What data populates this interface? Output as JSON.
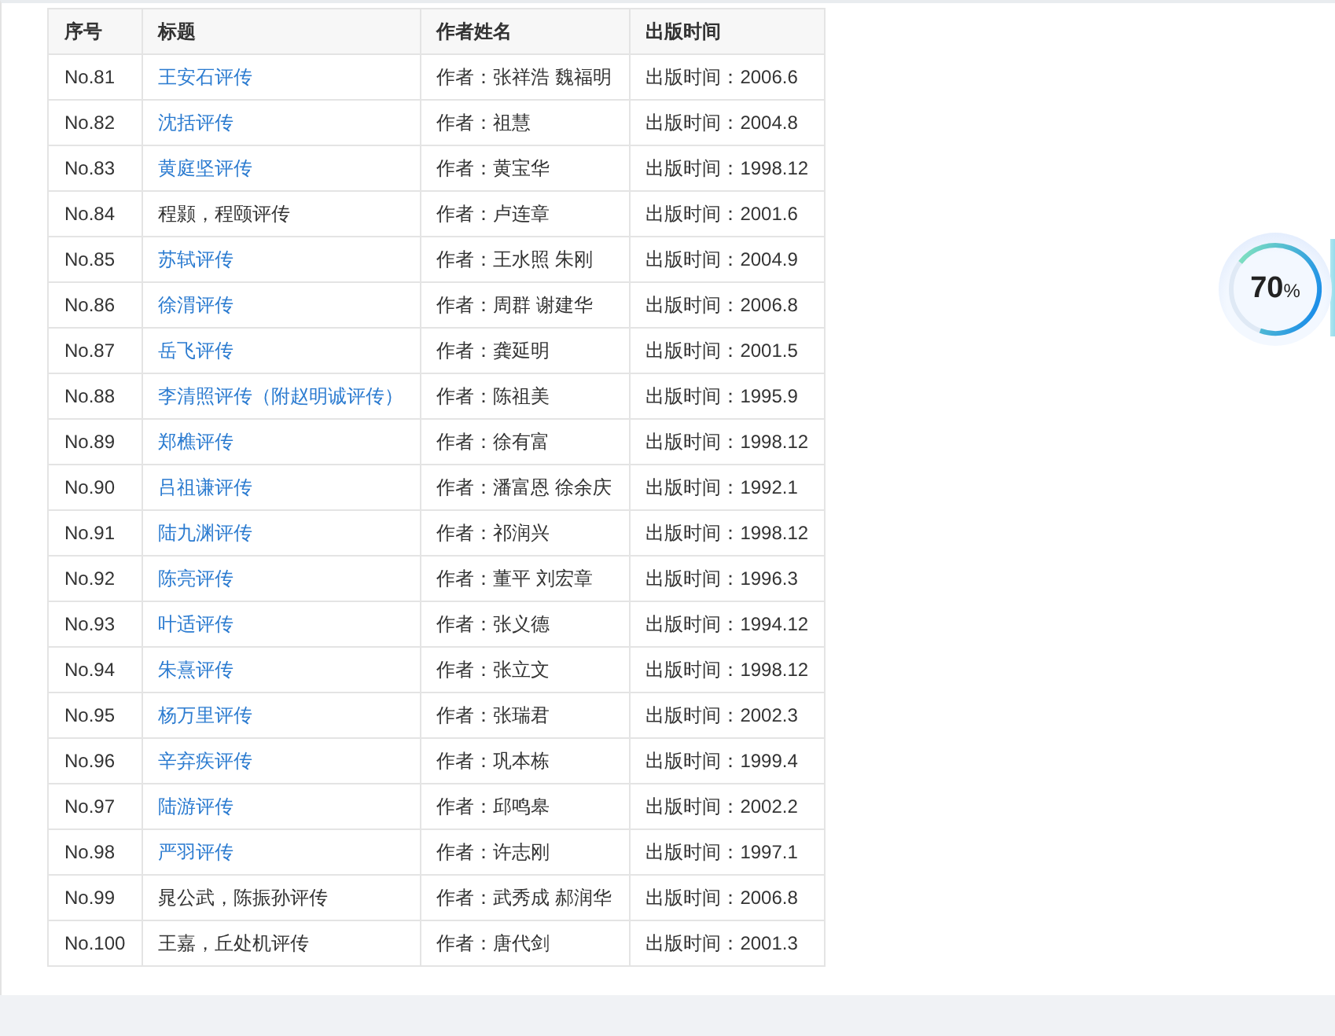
{
  "table": {
    "columns": [
      "序号",
      "标题",
      "作者姓名",
      "出版时间"
    ],
    "rows": [
      {
        "no": "No.81",
        "title": "王安石评传",
        "linked": true,
        "author": "作者：张祥浩 魏福明",
        "date": "出版时间：2006.6"
      },
      {
        "no": "No.82",
        "title": "沈括评传",
        "linked": true,
        "author": "作者：祖慧",
        "date": "出版时间：2004.8"
      },
      {
        "no": "No.83",
        "title": "黄庭坚评传",
        "linked": true,
        "author": "作者：黄宝华",
        "date": "出版时间：1998.12"
      },
      {
        "no": "No.84",
        "title": "程颢，程颐评传",
        "linked": false,
        "author": "作者：卢连章",
        "date": "出版时间：2001.6"
      },
      {
        "no": "No.85",
        "title": "苏轼评传",
        "linked": true,
        "author": "作者：王水照 朱刚",
        "date": "出版时间：2004.9"
      },
      {
        "no": "No.86",
        "title": "徐渭评传",
        "linked": true,
        "author": "作者：周群 谢建华",
        "date": "出版时间：2006.8"
      },
      {
        "no": "No.87",
        "title": "岳飞评传",
        "linked": true,
        "author": "作者：龚延明",
        "date": "出版时间：2001.5"
      },
      {
        "no": "No.88",
        "title": "李清照评传（附赵明诚评传）",
        "linked": true,
        "author": "作者：陈祖美",
        "date": "出版时间：1995.9"
      },
      {
        "no": "No.89",
        "title": "郑樵评传",
        "linked": true,
        "author": "作者：徐有富",
        "date": "出版时间：1998.12"
      },
      {
        "no": "No.90",
        "title": "吕祖谦评传",
        "linked": true,
        "author": "作者：潘富恩 徐余庆",
        "date": "出版时间：1992.1"
      },
      {
        "no": "No.91",
        "title": "陆九渊评传",
        "linked": true,
        "author": "作者：祁润兴",
        "date": "出版时间：1998.12"
      },
      {
        "no": "No.92",
        "title": "陈亮评传",
        "linked": true,
        "author": "作者：董平 刘宏章",
        "date": "出版时间：1996.3"
      },
      {
        "no": "No.93",
        "title": "叶适评传",
        "linked": true,
        "author": "作者：张义德",
        "date": "出版时间：1994.12"
      },
      {
        "no": "No.94",
        "title": "朱熹评传",
        "linked": true,
        "author": "作者：张立文",
        "date": "出版时间：1998.12"
      },
      {
        "no": "No.95",
        "title": "杨万里评传",
        "linked": true,
        "author": "作者：张瑞君",
        "date": "出版时间：2002.3"
      },
      {
        "no": "No.96",
        "title": "辛弃疾评传",
        "linked": true,
        "author": "作者：巩本栋",
        "date": "出版时间：1999.4"
      },
      {
        "no": "No.97",
        "title": "陆游评传",
        "linked": true,
        "author": "作者：邱鸣皋",
        "date": "出版时间：2002.2"
      },
      {
        "no": "No.98",
        "title": "严羽评传",
        "linked": true,
        "author": "作者：许志刚",
        "date": "出版时间：1997.1"
      },
      {
        "no": "No.99",
        "title": "晁公武，陈振孙评传",
        "linked": false,
        "author": "作者：武秀成 郝润华",
        "date": "出版时间：2006.8"
      },
      {
        "no": "No.100",
        "title": "王嘉，丘处机评传",
        "linked": false,
        "author": "作者：唐代剑",
        "date": "出版时间：2001.3"
      }
    ]
  },
  "progress": {
    "value": "70",
    "unit": "%",
    "level": 0.7
  }
}
